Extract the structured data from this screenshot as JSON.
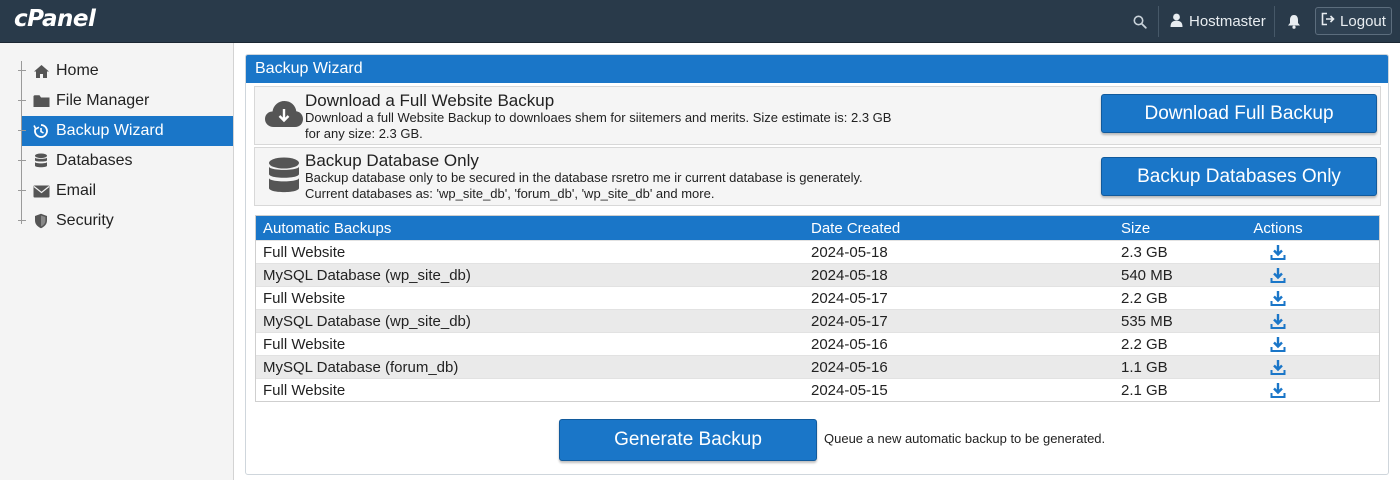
{
  "brand": {
    "logo_text": "cPanel"
  },
  "topbar": {
    "user_label": "Hostmaster",
    "logout_label": "Logout"
  },
  "sidebar": {
    "items": [
      {
        "label": "Home",
        "icon": "home-icon"
      },
      {
        "label": "File Manager",
        "icon": "folder-icon"
      },
      {
        "label": "Backup Wizard",
        "icon": "backup-icon",
        "active": true
      },
      {
        "label": "Databases",
        "icon": "database-icon"
      },
      {
        "label": "Email",
        "icon": "envelope-icon"
      },
      {
        "label": "Security",
        "icon": "shield-icon"
      }
    ]
  },
  "panel": {
    "title": "Backup Wizard",
    "full_backup": {
      "title": "Download a Full Website Backup",
      "desc_line1": "Download a full Website Backup to downloaes shem for siitemers and merits. Size estimate is: 2.3 GB",
      "desc_line2": "for any size: 2.3 GB.",
      "button_label": "Download Full Backup"
    },
    "db_backup": {
      "title": "Backup Database Only",
      "desc_line1": "Backup database only to be secured in the database rsretro me ir current database is generately.",
      "desc_line2": "Current databases as: 'wp_site_db', 'forum_db', 'wp_site_db' and more.",
      "button_label": "Backup Databases Only"
    },
    "table": {
      "headers": [
        "Automatic Backups",
        "Date Created",
        "Size",
        "Actions"
      ],
      "rows": [
        {
          "name": "Full Website",
          "date": "2024-05-18",
          "size": "2.3 GB"
        },
        {
          "name": "MySQL Database (wp_site_db)",
          "date": "2024-05-18",
          "size": "540 MB"
        },
        {
          "name": "Full Website",
          "date": "2024-05-17",
          "size": "2.2 GB"
        },
        {
          "name": "MySQL Database (wp_site_db)",
          "date": "2024-05-17",
          "size": "535 MB"
        },
        {
          "name": "Full Website",
          "date": "2024-05-16",
          "size": "2.2 GB"
        },
        {
          "name": "MySQL Database (forum_db)",
          "date": "2024-05-16",
          "size": "1.1 GB"
        },
        {
          "name": "Full Website",
          "date": "2024-05-15",
          "size": "2.1 GB"
        }
      ]
    },
    "generate": {
      "button_label": "Generate Backup",
      "note": "Queue a new automatic backup to be generated."
    }
  },
  "colors": {
    "accent": "#1a76c8",
    "topbar": "#293a4a",
    "sidebar_bg": "#f4f4f4"
  }
}
